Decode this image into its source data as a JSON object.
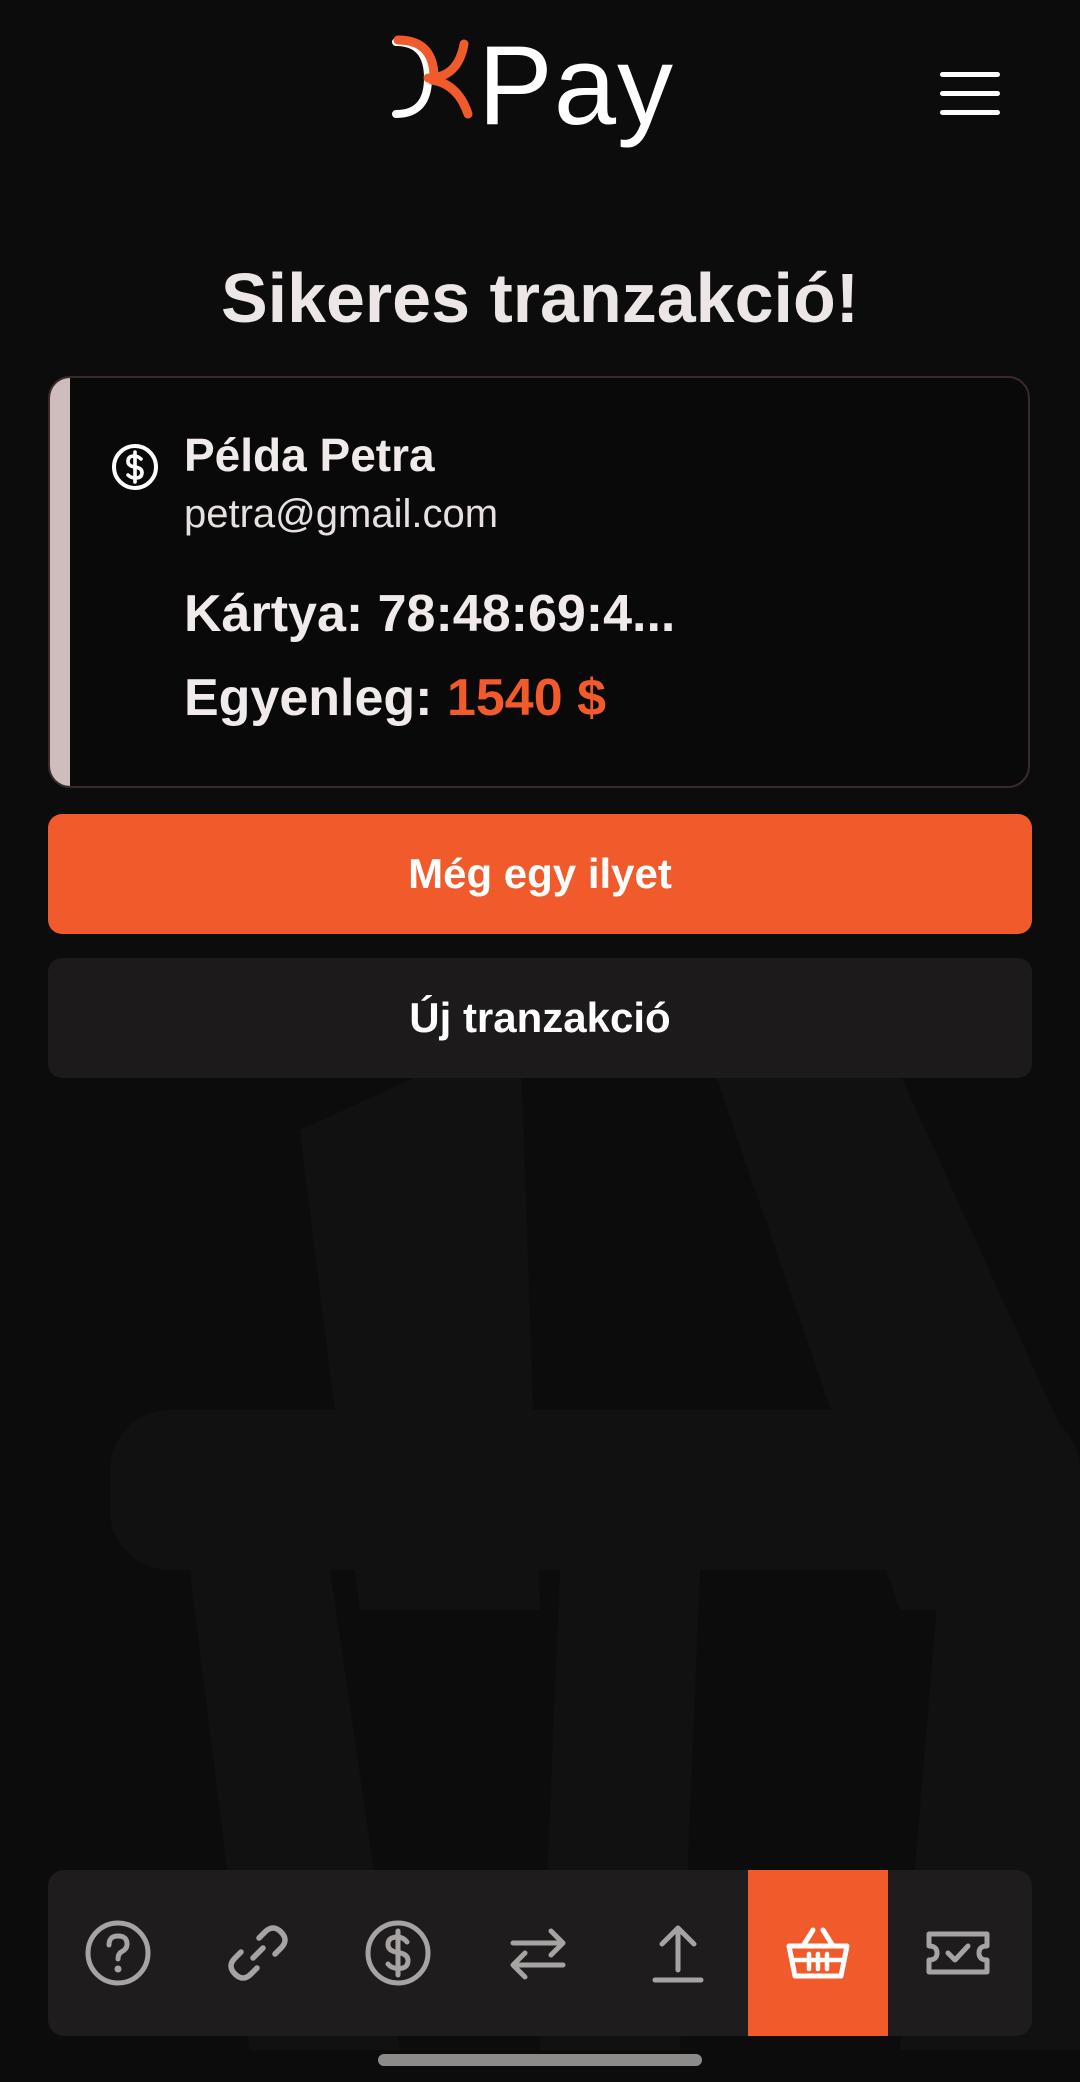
{
  "header": {
    "brand": "Pay",
    "logo_icon": "xr-logo-mark",
    "menu_icon": "hamburger-icon"
  },
  "title": "Sikeres tranzakció!",
  "card": {
    "icon": "dollar-circle-icon",
    "name": "Példa Petra",
    "email": "petra@gmail.com",
    "card_label": "Kártya:",
    "card_value": "78:48:69:4...",
    "balance_label": "Egyenleg:",
    "balance_value": "1540 $"
  },
  "buttons": {
    "primary": "Még egy ilyet",
    "secondary": "Új tranzakció"
  },
  "tabbar": {
    "tabs": [
      {
        "icon": "help-circle-icon",
        "active": false
      },
      {
        "icon": "link-icon",
        "active": false
      },
      {
        "icon": "dollar-circle-icon",
        "active": false
      },
      {
        "icon": "transfer-arrows-icon",
        "active": false
      },
      {
        "icon": "upload-icon",
        "active": false
      },
      {
        "icon": "basket-icon",
        "active": true
      },
      {
        "icon": "ticket-check-icon",
        "active": false
      }
    ]
  },
  "colors": {
    "accent": "#f15a2b",
    "background": "#0d0c0c",
    "card_border": "#3b2a2a",
    "tabbar": "#1e1c1c"
  }
}
